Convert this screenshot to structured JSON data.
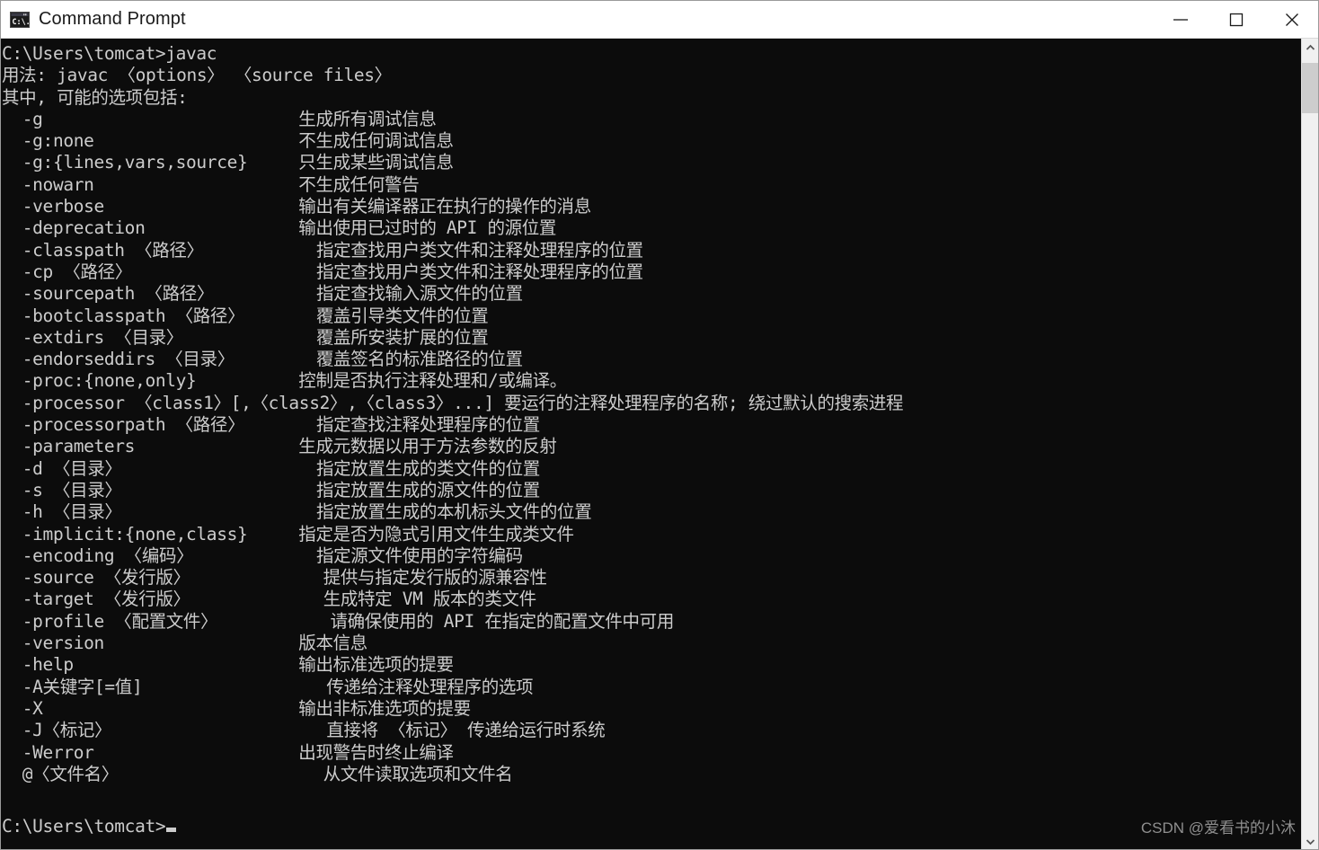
{
  "window": {
    "title": "Command Prompt",
    "icon": "console-icon",
    "minimize_label": "—",
    "maximize_label": "□",
    "close_label": "✕",
    "background_color": "#0c0c0c",
    "text_color": "#cccccc",
    "titlebar_color": "#ffffff"
  },
  "console": {
    "text": "C:\\Users\\tomcat>javac\n用法: javac 〈options〉 〈source files〉\n其中, 可能的选项包括:\n  -g                         生成所有调试信息\n  -g:none                    不生成任何调试信息\n  -g:{lines,vars,source}     只生成某些调试信息\n  -nowarn                    不生成任何警告\n  -verbose                   输出有关编译器正在执行的操作的消息\n  -deprecation               输出使用已过时的 API 的源位置\n  -classpath 〈路径〉           指定查找用户类文件和注释处理程序的位置\n  -cp 〈路径〉                  指定查找用户类文件和注释处理程序的位置\n  -sourcepath 〈路径〉          指定查找输入源文件的位置\n  -bootclasspath 〈路径〉       覆盖引导类文件的位置\n  -extdirs 〈目录〉             覆盖所安装扩展的位置\n  -endorseddirs 〈目录〉        覆盖签名的标准路径的位置\n  -proc:{none,only}          控制是否执行注释处理和/或编译。\n  -processor 〈class1〉[,〈class2〉,〈class3〉...] 要运行的注释处理程序的名称; 绕过默认的搜索进程\n  -processorpath 〈路径〉       指定查找注释处理程序的位置\n  -parameters                生成元数据以用于方法参数的反射\n  -d 〈目录〉                   指定放置生成的类文件的位置\n  -s 〈目录〉                   指定放置生成的源文件的位置\n  -h 〈目录〉                   指定放置生成的本机标头文件的位置\n  -implicit:{none,class}     指定是否为隐式引用文件生成类文件\n  -encoding 〈编码〉            指定源文件使用的字符编码\n  -source 〈发行版〉             提供与指定发行版的源兼容性\n  -target 〈发行版〉             生成特定 VM 版本的类文件\n  -profile 〈配置文件〉           请确保使用的 API 在指定的配置文件中可用\n  -version                   版本信息\n  -help                      输出标准选项的提要\n  -A关键字[=值]                  传递给注释处理程序的选项\n  -X                         输出非标准选项的提要\n  -J〈标记〉                     直接将 〈标记〉 传递给运行时系统\n  -Werror                    出现警告时终止编译\n  @〈文件名〉                    从文件读取选项和文件名",
    "prompt": "C:\\Users\\tomcat>",
    "cursor": "block-cursor"
  },
  "watermark": {
    "text": "CSDN @爱看书的小沐"
  },
  "scrollbar": {
    "up_arrow": "chevron-up-icon",
    "down_arrow": "chevron-down-icon",
    "thumb": "scrollbar-thumb"
  }
}
